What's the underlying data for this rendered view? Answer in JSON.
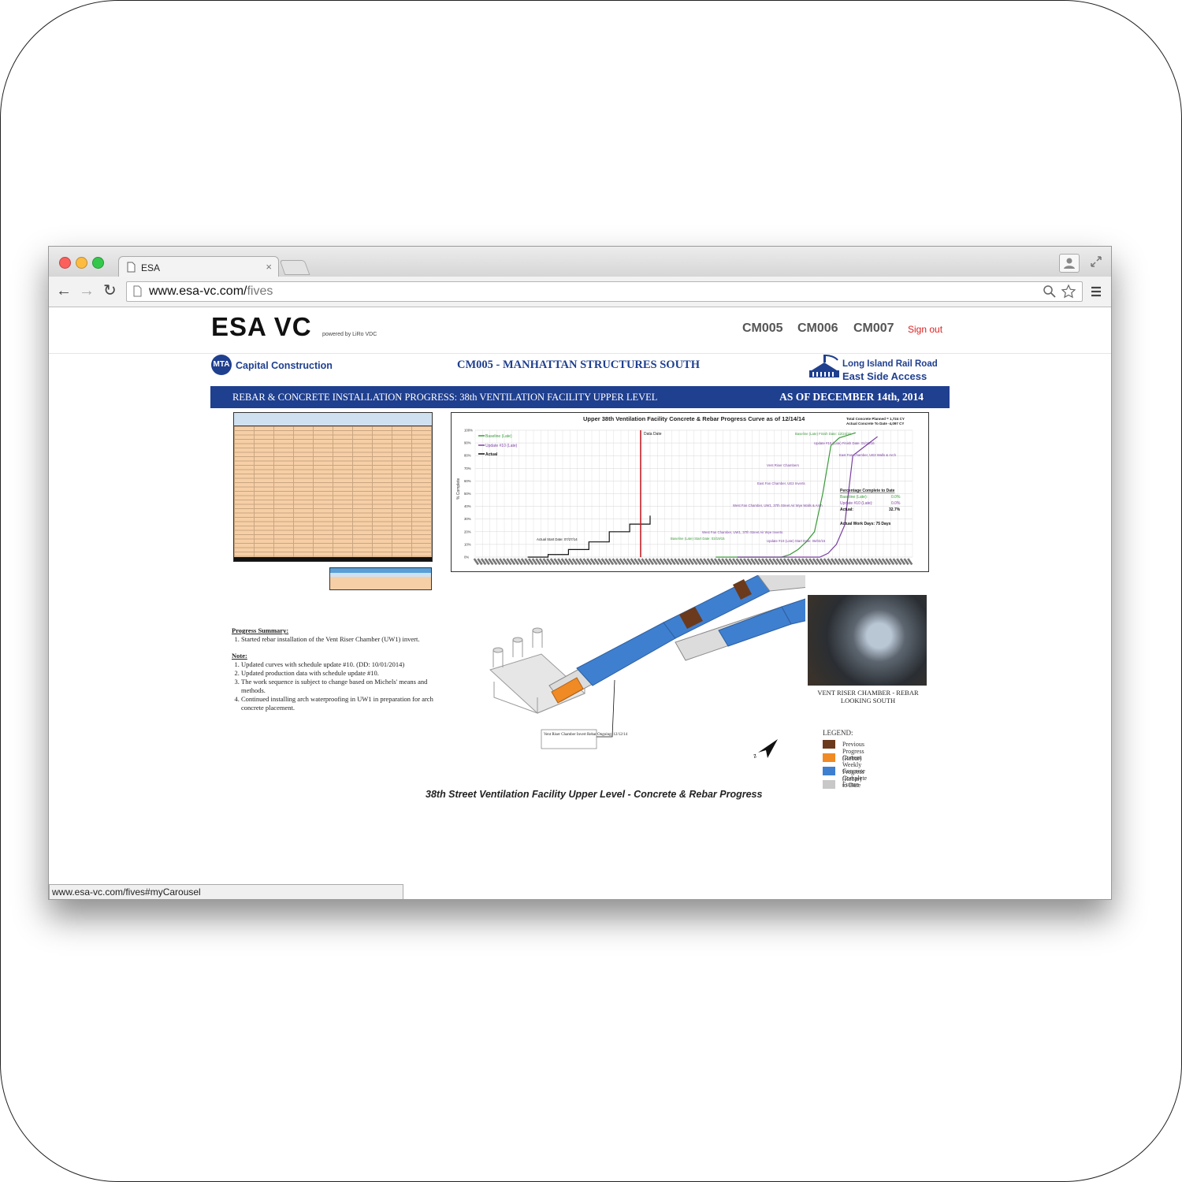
{
  "browser": {
    "tab_title": "ESA",
    "tab_close": "×",
    "url_domain": "www.esa-vc.com/",
    "url_path": "fives",
    "status_url": "www.esa-vc.com/fives#myCarousel"
  },
  "site": {
    "logo": "ESA VC",
    "powered": "powered by LiRo VDC",
    "nav": [
      "CM005",
      "CM006",
      "CM007"
    ],
    "signout": "Sign out"
  },
  "report": {
    "left_brand": "Capital Construction",
    "mta_badge": "MTA",
    "title": "CM005 - MANHATTAN STRUCTURES SOUTH",
    "right_brand_1": "Long Island Rail Road",
    "right_brand_2": "East Side Access",
    "banner_left": "REBAR & CONCRETE INSTALLATION PROGRESS:  38th VENTILATION FACILITY UPPER LEVEL",
    "banner_right": "AS OF DECEMBER 14th, 2014",
    "model_caption": "38th Street Ventilation Facility Upper Level - Concrete & Rebar Progress",
    "model_callout": "Vent Riser Chamber Invert Rebar Ongoing: 12/12/14",
    "photo_caption_1": "VENT RISER CHAMBER - REBAR",
    "photo_caption_2": "LOOKING SOUTH",
    "summary_title": "Progress Summary:",
    "summary_items": [
      "Started rebar installation of the Vent Riser Chamber (UW1) invert."
    ],
    "note_title": "Note:",
    "notes": [
      "Updated curves with schedule update #10.  (DD:  10/01/2014)",
      "Updated production data with schedule update #10.",
      "The work sequence is subject to change based on Michels' means and methods.",
      "Continued installing arch waterproofing in UW1 in preparation for arch concrete placement."
    ],
    "legend_title": "LEGEND:",
    "legend": [
      {
        "label": "Previous Progress (Rebar)",
        "color": "#6b3a1c"
      },
      {
        "label": "Current Weekly Progress (Rebar)",
        "color": "#f08a24"
      },
      {
        "label": "Concrete Complete to Date",
        "color": "#3f7fd0"
      },
      {
        "label": "Future",
        "color": "#c8c8c8"
      }
    ]
  },
  "chart_data": {
    "type": "line",
    "title": "Upper 38th Ventilation Facility Concrete & Rebar Progress Curve as of 12/14/14",
    "ylabel": "% Complete",
    "ylim": [
      0,
      100
    ],
    "yticks": [
      "100%",
      "90%",
      "80%",
      "70%",
      "60%",
      "50%",
      "40%",
      "30%",
      "20%",
      "10%",
      "0%"
    ],
    "series": [
      {
        "name": "Baseline (Late)",
        "color": "#3a9a3a",
        "values": [
          0,
          0,
          0,
          0,
          0,
          0,
          0,
          0,
          0,
          2,
          6,
          12,
          20,
          50,
          88,
          94,
          96,
          98
        ]
      },
      {
        "name": "Update #10 (Late)",
        "color": "#7a3fa0",
        "values": [
          0,
          0,
          0,
          0,
          0,
          0,
          0,
          0,
          0,
          0,
          0,
          3,
          10,
          25,
          80,
          85,
          90,
          95
        ]
      },
      {
        "name": "Actual",
        "color": "#111111",
        "values": [
          0,
          2,
          6,
          12,
          20,
          26,
          32.7
        ]
      }
    ],
    "annotations": {
      "totals_1": "Total Concrete Planned = 1,724 CY",
      "totals_2": "Actual Concrete To Date -4,097 CY",
      "data_date": "Data Date",
      "pct_title": "Percentage Complete to Date",
      "pct_baseline": "Baseline (Late):",
      "pct_baseline_val": "0.0%",
      "pct_update": "Update #10 (Late):",
      "pct_update_val": "0.0%",
      "pct_actual": "Actual:",
      "pct_actual_val": "32.7%",
      "workdays": "Actual Work Days:  75 Days",
      "actual_start": "Actual Start Date: 07/27/14",
      "baseline_finish": "Baseline (Late) Finish Date: 12/24/15",
      "update_finish": "Update #10 (Late) Finish Date: 01/19/16",
      "vent_riser": "Vent Riser Chambers",
      "east_fan_inverts": "East Fan Chamber, UE3 Inverts",
      "east_fan_walls": "East Fan Chamber, UE3 Walls & Arch",
      "west_fan_walls": "West Fan Chamber, UW1, 37th Street Air Wye Walls & Arch",
      "west_fan_inverts": "West Fan Chamber, UW1, 37th Street Air Wye Inverts",
      "baseline_start": "Baseline (Late) Start Date: 03/19/15",
      "update_start": "Update #10 (Late) Start Date: 06/02/15"
    }
  }
}
